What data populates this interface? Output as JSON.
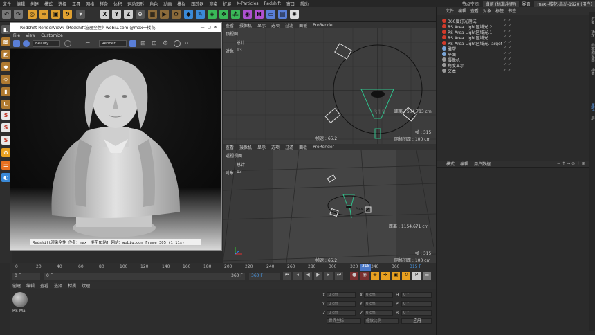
{
  "menubar": {
    "items": [
      "文件",
      "编辑",
      "创建",
      "模式",
      "选择",
      "工具",
      "网格",
      "样条",
      "体积",
      "运动图形",
      "角色",
      "动画",
      "模拟",
      "跟踪器",
      "渲染",
      "扩展",
      "X-Particles",
      "Redshift",
      "窗口",
      "帮助"
    ],
    "node_space_label": "节点空间:",
    "node_space_value": "当前 (标准/物理)",
    "interface_label": "界面:",
    "interface_value": "max--楼花-启动-1920 (用户)"
  },
  "render_view": {
    "title": "Redshift RenderView:《Redshift渲器全性》wobiu.com @max一楼花",
    "menu": [
      "File",
      "View",
      "Customize"
    ],
    "aov": "Beauty",
    "render_label": "Render",
    "caption": "Redshift渲染全性  作者：max一楼花[B站]  网站：wobiu.com  Frame  305  (1.11s)"
  },
  "viewport_top": {
    "menu": [
      "查看",
      "摄像机",
      "显示",
      "选项",
      "过滤",
      "面板",
      "ProRender"
    ],
    "name": "顶视图",
    "stats_total": "总计",
    "stats_objects_label": "对象",
    "stats_objects_value": "13",
    "distance": "距离 : 504.783 cm",
    "frame_num": "315",
    "fps": "帧速 : 65.2",
    "frame": "帧 : 315",
    "grid": "网格间距 : 100 cm"
  },
  "viewport_persp": {
    "menu": [
      "查看",
      "摄像机",
      "显示",
      "选项",
      "过滤",
      "面板",
      "ProRender"
    ],
    "name": "透视视图",
    "stats_total": "总计",
    "stats_objects_label": "对象",
    "stats_objects_value": "13",
    "distance": "距离 : 1154.671 cm",
    "fps": "帧速 : 65.2",
    "frame": "帧 : 315",
    "grid": "网格间距 : 100 cm",
    "tag": "Max"
  },
  "timeline": {
    "ticks": [
      "0",
      "20",
      "40",
      "60",
      "80",
      "100",
      "120",
      "140",
      "160",
      "180",
      "200",
      "220",
      "240",
      "260",
      "280",
      "300",
      "320",
      "340",
      "360"
    ],
    "current_marker": "315",
    "current_frame_label": "315 F",
    "start": "0 F",
    "range_start": "0 F",
    "range_end": "360 F",
    "end": "360 F"
  },
  "material_panel": {
    "menu": [
      "创建",
      "编辑",
      "查看",
      "选择",
      "材质",
      "纹理"
    ],
    "material_name": "RS Ma"
  },
  "coord_panel": {
    "rows": [
      {
        "a": "X",
        "av": "0 cm",
        "b": "X",
        "bv": "0 cm",
        "c": "H",
        "cv": "0 °"
      },
      {
        "a": "Y",
        "av": "0 cm",
        "b": "Y",
        "bv": "0 cm",
        "c": "P",
        "cv": "0 °"
      },
      {
        "a": "Z",
        "av": "0 cm",
        "b": "Z",
        "bv": "0 cm",
        "c": "B",
        "cv": "0 °"
      }
    ],
    "mode": "世界坐标",
    "scale": "缩放比例",
    "apply": "应用"
  },
  "object_manager": {
    "menu": [
      "文件",
      "编辑",
      "查看",
      "对象",
      "标签",
      "书签"
    ],
    "objects": [
      {
        "name": "360度灯光测试",
        "color": "#d23b2b"
      },
      {
        "name": "RS Area Light区域光.2",
        "color": "#d23b2b"
      },
      {
        "name": "RS Area Light区域光.1",
        "color": "#d23b2b"
      },
      {
        "name": "RS Area Light区域光",
        "color": "#d23b2b"
      },
      {
        "name": "RS Area Light区域光.Target",
        "color": "#d23b2b"
      },
      {
        "name": "雕塑",
        "color": "#7aa6d8"
      },
      {
        "name": "平面",
        "color": "#7aa6d8"
      },
      {
        "name": "摄像机",
        "color": "#9a9a9a"
      },
      {
        "name": "角度显示",
        "color": "#9a9a9a"
      },
      {
        "name": "文本",
        "color": "#9a9a9a"
      }
    ]
  },
  "attribute_manager": {
    "menu": [
      "模式",
      "编辑",
      "用户数据"
    ]
  },
  "side_tabs": [
    "对象",
    "场次",
    "内容浏览器",
    "构造",
    "属性",
    "层"
  ]
}
